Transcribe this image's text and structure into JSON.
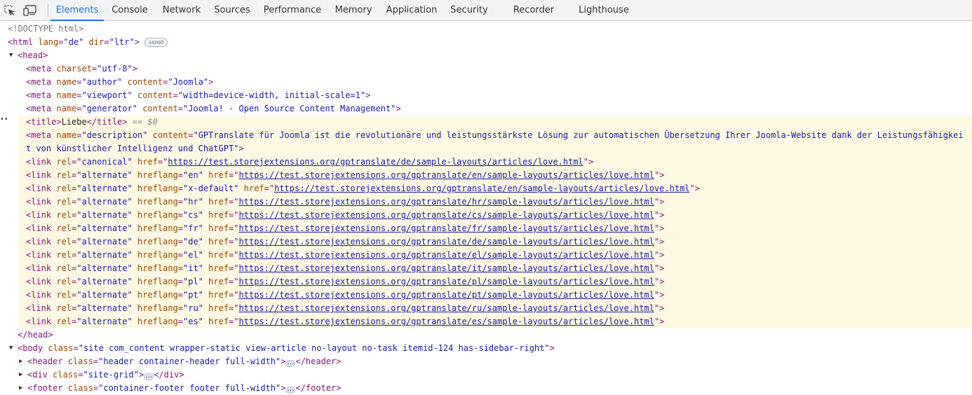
{
  "toolbar": {
    "tabs": [
      {
        "label": "Elements",
        "active": true
      },
      {
        "label": "Console"
      },
      {
        "label": "Network"
      },
      {
        "label": "Sources"
      },
      {
        "label": "Performance"
      },
      {
        "label": "Memory"
      },
      {
        "label": "Application"
      },
      {
        "label": "Security"
      },
      {
        "label": "Recorder"
      },
      {
        "label": "Lighthouse"
      }
    ],
    "icons": [
      "inspect-element-icon",
      "device-toolbar-icon"
    ]
  },
  "tree": {
    "doctype": "<!DOCTYPE html>",
    "html_open_prefix": "<html ",
    "html_lang_attr": "lang",
    "html_lang_val": "\"de\"",
    "html_dir_attr": "dir",
    "html_dir_val": "\"ltr\"",
    "html_open_suffix": ">",
    "scroll_badge": "scroll",
    "head_open": "<head>",
    "meta_charset": {
      "attr": "charset",
      "val": "\"utf-8\""
    },
    "meta_author": {
      "name_val": "\"author\"",
      "content_val": "\"Joomla\""
    },
    "meta_viewport": {
      "name_val": "\"viewport\"",
      "content_val": "\"width=device-width, initial-scale=1\""
    },
    "meta_generator": {
      "name_val": "\"generator\"",
      "content_val": "\"Joomla! - Open Source Content Management\""
    },
    "title": {
      "text": "Liebe",
      "selected_marker": "== $0"
    },
    "meta_description": {
      "name_val": "\"description\"",
      "content_line1": "\"GPTranslate für Joomla ist die revolutionäre und leistungsstärkste Lösung zur automatischen Übersetzung Ihrer Joomla-Website dank der Leistungsfähigkei",
      "content_line2": "t von künstlicher Intelligenz und ChatGPT\""
    },
    "canonical": {
      "rel_val": "\"canonical\"",
      "href": "https://test.storejextensions.org/gptranslate/de/sample-layouts/articles/love.html"
    },
    "alternates": [
      {
        "lang": "\"en\"",
        "href": "https://test.storejextensions.org/gptranslate/en/sample-layouts/articles/love.html"
      },
      {
        "lang": "\"x-default\"",
        "href": "https://test.storejextensions.org/gptranslate/en/sample-layouts/articles/love.html"
      },
      {
        "lang": "\"hr\"",
        "href": "https://test.storejextensions.org/gptranslate/hr/sample-layouts/articles/love.html"
      },
      {
        "lang": "\"cs\"",
        "href": "https://test.storejextensions.org/gptranslate/cs/sample-layouts/articles/love.html"
      },
      {
        "lang": "\"fr\"",
        "href": "https://test.storejextensions.org/gptranslate/fr/sample-layouts/articles/love.html"
      },
      {
        "lang": "\"de\"",
        "href": "https://test.storejextensions.org/gptranslate/de/sample-layouts/articles/love.html"
      },
      {
        "lang": "\"el\"",
        "href": "https://test.storejextensions.org/gptranslate/el/sample-layouts/articles/love.html"
      },
      {
        "lang": "\"it\"",
        "href": "https://test.storejextensions.org/gptranslate/it/sample-layouts/articles/love.html"
      },
      {
        "lang": "\"pl\"",
        "href": "https://test.storejextensions.org/gptranslate/pl/sample-layouts/articles/love.html"
      },
      {
        "lang": "\"pt\"",
        "href": "https://test.storejextensions.org/gptranslate/pt/sample-layouts/articles/love.html"
      },
      {
        "lang": "\"ru\"",
        "href": "https://test.storejextensions.org/gptranslate/ru/sample-layouts/articles/love.html"
      },
      {
        "lang": "\"es\"",
        "href": "https://test.storejextensions.org/gptranslate/es/sample-layouts/articles/love.html"
      }
    ],
    "head_close": "</head>",
    "body_class": "\"site com_content wrapper-static view-article no-layout no-task itemid-124 has-sidebar-right\"",
    "header_class": "\"header container-header full-width\"",
    "div_class": "\"site-grid\"",
    "footer_class": "\"container-footer footer full-width\""
  }
}
